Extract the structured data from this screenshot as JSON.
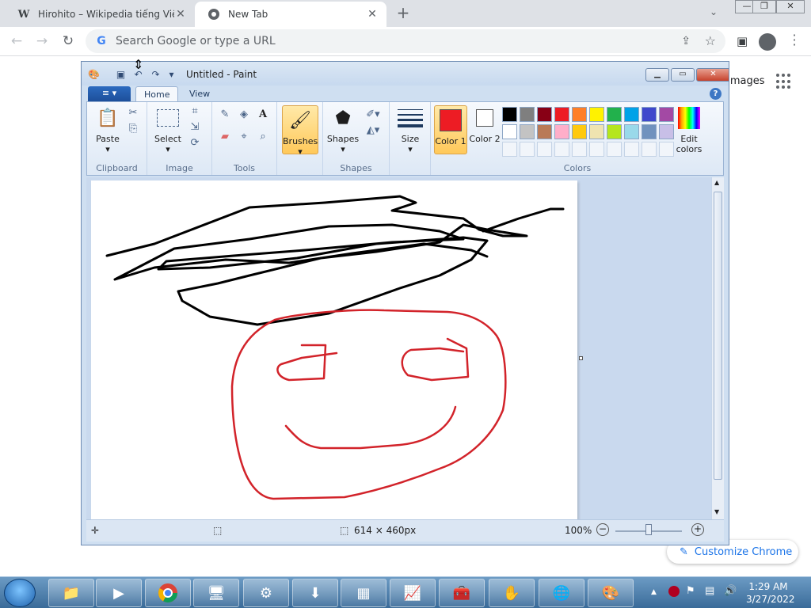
{
  "browser": {
    "tabs": [
      {
        "favicon": "W",
        "title": "Hirohito – Wikipedia tiếng Việt",
        "active": false
      },
      {
        "favicon": "chrome-icon",
        "title": "New Tab",
        "active": true
      }
    ],
    "omnibox_placeholder": "Search Google or type a URL",
    "page": {
      "images_link": "Images",
      "customize_label": "Customize Chrome"
    }
  },
  "paint": {
    "title": "Untitled - Paint",
    "file_menu": "≡",
    "ribbon_tabs": [
      "Home",
      "View"
    ],
    "groups": {
      "clipboard": {
        "label": "Clipboard",
        "paste": "Paste"
      },
      "image": {
        "label": "Image",
        "select": "Select"
      },
      "tools": {
        "label": "Tools"
      },
      "brushes": {
        "label": "Brushes"
      },
      "shapes": {
        "label": "Shapes",
        "shapes_btn": "Shapes"
      },
      "size": {
        "label": "Size"
      },
      "colors": {
        "label": "Colors",
        "color1": "Color 1",
        "color2": "Color 2",
        "edit_colors": "Edit colors",
        "color1_value": "#ed1c24",
        "color2_value": "#ffffff",
        "palette": [
          "#000000",
          "#7f7f7f",
          "#880015",
          "#ed1c24",
          "#ff7f27",
          "#fff200",
          "#22b14c",
          "#00a2e8",
          "#3f48cc",
          "#a349a4",
          "#ffffff",
          "#c3c3c3",
          "#b97a57",
          "#ffaec9",
          "#ffc90e",
          "#efe4b0",
          "#b5e61d",
          "#99d9ea",
          "#7092be",
          "#c8bfe7"
        ]
      }
    },
    "status": {
      "canvas_size": "614 × 460px",
      "zoom": "100%"
    }
  },
  "taskbar": {
    "clock_time": "1:29 AM",
    "clock_date": "3/27/2022"
  }
}
